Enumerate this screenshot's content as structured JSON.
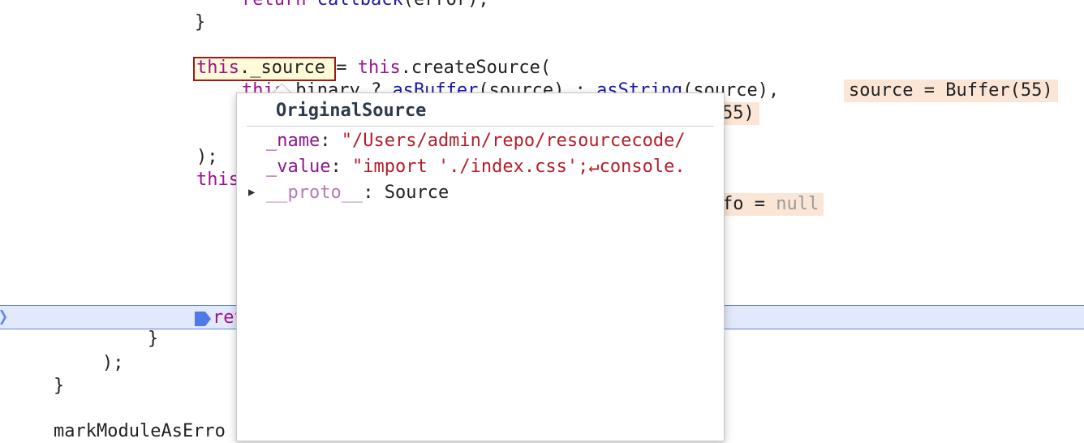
{
  "code": {
    "l1": {
      "kw": "return",
      "fn": "callback",
      "rest": "(error);"
    },
    "l2": "}",
    "l3": {
      "this1": "this",
      "src": "._source",
      "eq": " = ",
      "this2": "this",
      "call": ".createSource("
    },
    "l4": {
      "this": "this",
      "partial": ".binary ? ",
      "fn1": "asBuffer",
      "mid": "(source) : ",
      "fn2": "asString",
      "end": "(source),",
      "inline": "source = Buffer(55)"
    },
    "l5": {
      "inline": "55)"
    },
    "l6": ");",
    "l7": "this",
    "l8": {
      "partial": "fo",
      "eq": " = ",
      "val": "null"
    },
    "l9": "ret",
    "l10": "}",
    "l11": ");",
    "l12": "}",
    "l13": "markModuleAsErro"
  },
  "popover": {
    "title": "OriginalSource",
    "props": [
      {
        "name": "_name",
        "sep": ": ",
        "value": "\"/Users/admin/repo/resourcecode/"
      },
      {
        "name": "_value",
        "sep": ": ",
        "value": "\"import './index.css';↵console."
      },
      {
        "name": "__proto__",
        "sep": ": ",
        "value": "Source"
      }
    ]
  }
}
